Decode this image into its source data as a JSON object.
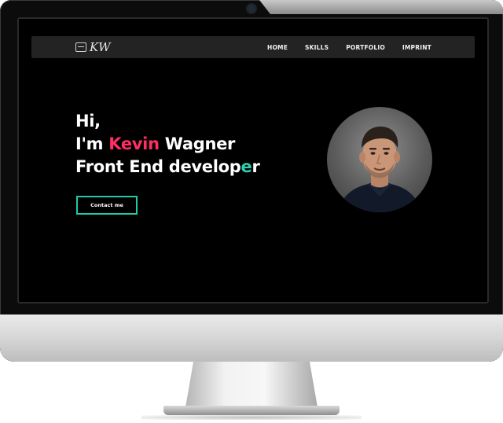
{
  "site": {
    "logo_text": "KW",
    "nav": [
      {
        "label": "HOME"
      },
      {
        "label": "SKILLS"
      },
      {
        "label": "PORTFOLIO"
      },
      {
        "label": "IMPRINT"
      }
    ]
  },
  "hero": {
    "line1": "Hi,",
    "line2_prefix": "I'm ",
    "line2_name": "Kevin",
    "line2_suffix": " Wagner",
    "line3_main": "Front End develop",
    "line3_accent": "e",
    "line3_end": "r",
    "button_label": "Contact me"
  },
  "colors": {
    "background": "#000000",
    "navbar": "#232323",
    "accent_pink": "#ff2e63",
    "accent_teal": "#2ad1b0"
  },
  "icons": {
    "logo": "laptop-icon",
    "avatar": "profile-photo"
  }
}
